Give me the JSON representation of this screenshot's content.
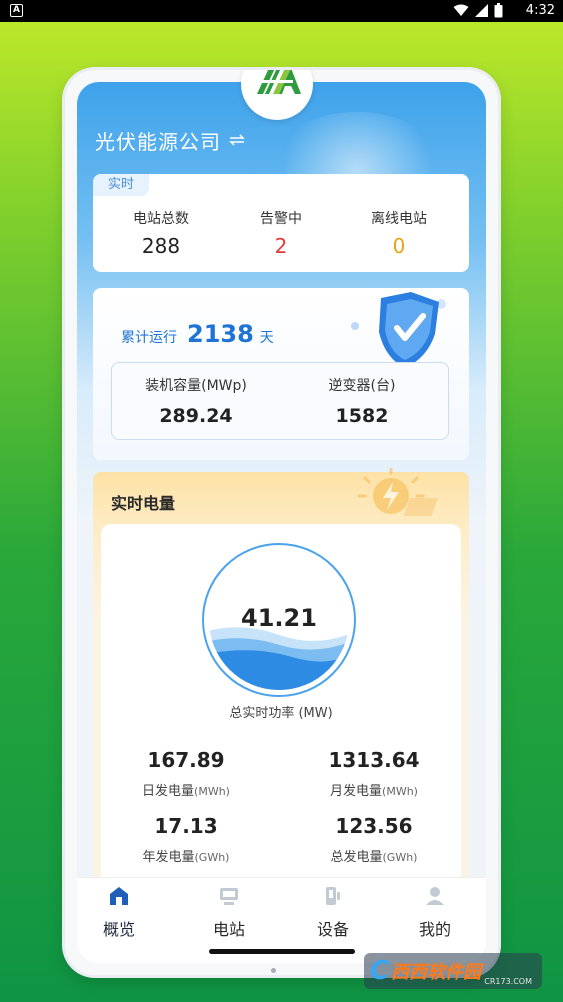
{
  "status_bar": {
    "time": "4:32",
    "app_letter": "A"
  },
  "header": {
    "company_name": "光伏能源公司"
  },
  "realtime": {
    "tag": "实时",
    "stations_label": "电站总数",
    "stations_value": "288",
    "alarm_label": "告警中",
    "alarm_value": "2",
    "offline_label": "离线电站",
    "offline_value": "0"
  },
  "run": {
    "prefix": "累计运行",
    "days": "2138",
    "suffix": "天",
    "capacity_label": "装机容量(MWp)",
    "capacity_value": "289.24",
    "inverter_label": "逆变器(台)",
    "inverter_value": "1582"
  },
  "power": {
    "title": "实时电量",
    "total_power_value": "41.21",
    "total_power_label": "总实时功率 (MW)",
    "gauge_fill": 0.38,
    "daily_value": "167.89",
    "daily_label": "日发电量",
    "daily_unit": "(MWh)",
    "monthly_value": "1313.64",
    "monthly_label": "月发电量",
    "monthly_unit": "(MWh)",
    "yearly_value": "17.13",
    "yearly_label": "年发电量",
    "yearly_unit": "(GWh)",
    "total_value": "123.56",
    "total_label": "总发电量",
    "total_unit": "(GWh)"
  },
  "nav": {
    "items": [
      {
        "label": "概览",
        "icon": "overview-icon",
        "active": true
      },
      {
        "label": "电站",
        "icon": "station-icon",
        "active": false
      },
      {
        "label": "设备",
        "icon": "device-icon",
        "active": false
      },
      {
        "label": "我的",
        "icon": "profile-icon",
        "active": false
      }
    ]
  },
  "colors": {
    "primary_blue": "#1e73d6",
    "alarm_red": "#e03a3a",
    "offline_amber": "#e8a317",
    "nav_active": "#1f5fb8",
    "nav_inactive": "#9aa6b2"
  },
  "watermark": {
    "text": "西西软件园",
    "sub": "CR173.COM"
  }
}
